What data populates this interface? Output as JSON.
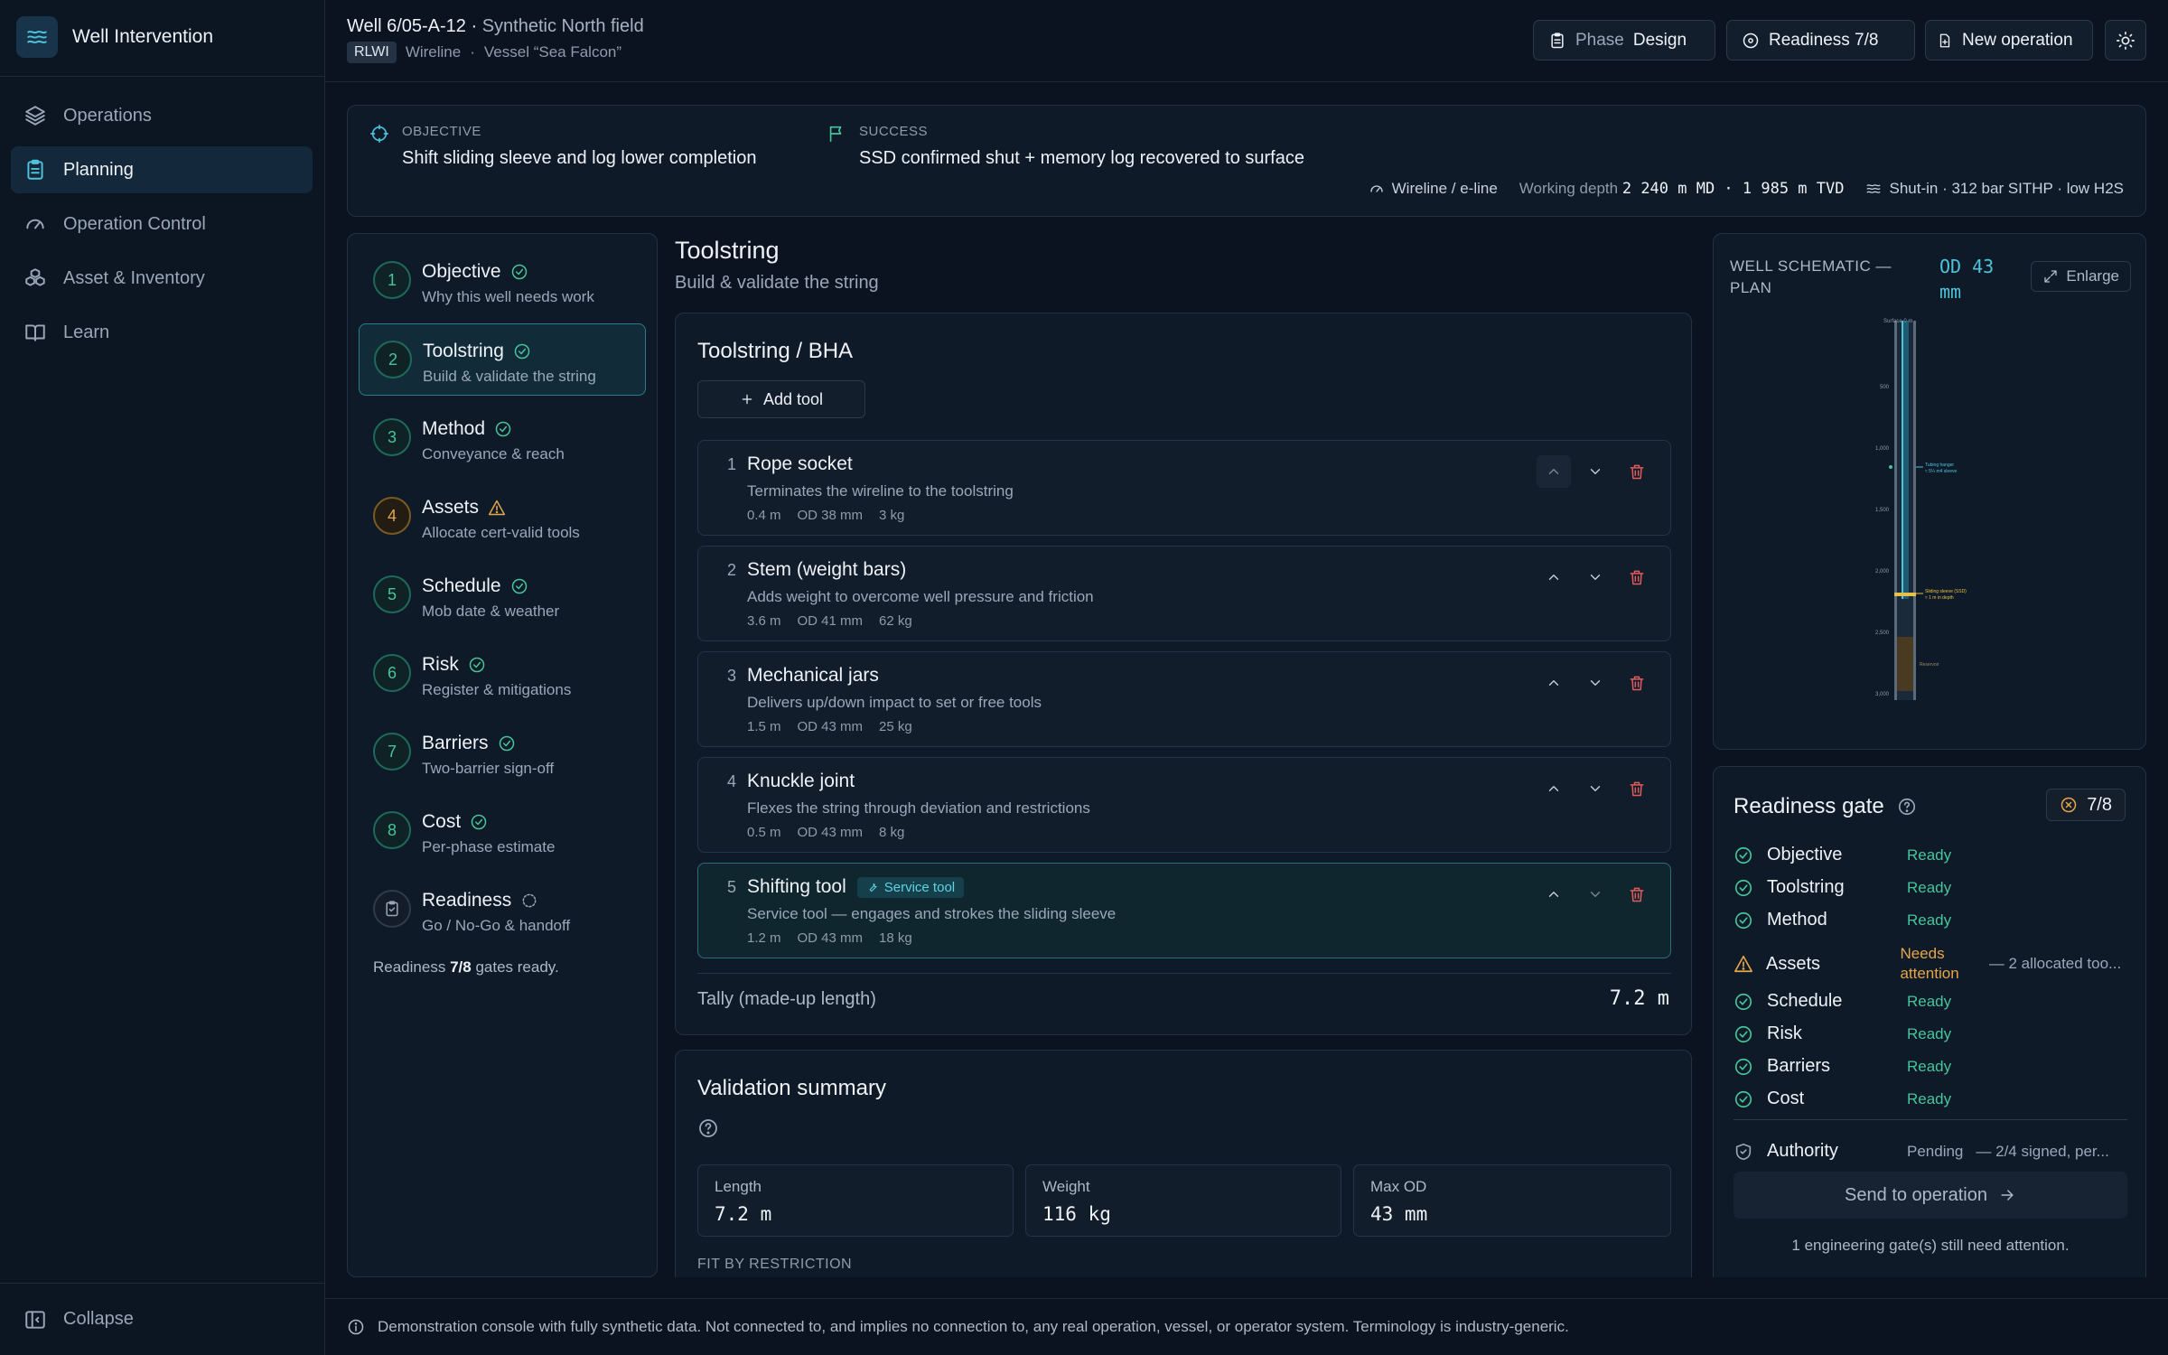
{
  "app": {
    "title": "Well Intervention"
  },
  "nav": [
    {
      "label": "Operations",
      "icon": "layers-icon"
    },
    {
      "label": "Planning",
      "icon": "clipboard-icon",
      "active": true
    },
    {
      "label": "Operation Control",
      "icon": "gauge-icon"
    },
    {
      "label": "Asset & Inventory",
      "icon": "boxes-icon"
    },
    {
      "label": "Learn",
      "icon": "book-icon"
    }
  ],
  "collapse_label": "Collapse",
  "header": {
    "well": "Well 6/05-A-12",
    "dot": "·",
    "field": "Synthetic North field",
    "tag": "RLWI",
    "mode": "Wireline",
    "vessel": "Vessel “Sea Falcon”",
    "phase_label": "Phase",
    "phase_value": "Design",
    "readiness": "Readiness 7/8",
    "new_operation": "New operation"
  },
  "banner": {
    "objective_label": "OBJECTIVE",
    "objective": "Shift sliding sleeve and log lower completion",
    "success_label": "SUCCESS",
    "success": "SSD confirmed shut + memory log recovered to surface",
    "conveyance": "Wireline / e-line",
    "depth_label": "Working depth",
    "depth": "2 240 m MD · 1 985 m TVD",
    "well_state": "Shut-in · 312 bar SITHP · low H2S"
  },
  "steps": [
    {
      "num": "1",
      "title": "Objective",
      "sub": "Why this well needs work",
      "state": "ok"
    },
    {
      "num": "2",
      "title": "Toolstring",
      "sub": "Build & validate the string",
      "state": "ok"
    },
    {
      "num": "3",
      "title": "Method",
      "sub": "Conveyance & reach",
      "state": "ok"
    },
    {
      "num": "4",
      "title": "Assets",
      "sub": "Allocate cert-valid tools",
      "state": "warn"
    },
    {
      "num": "5",
      "title": "Schedule",
      "sub": "Mob date & weather",
      "state": "ok"
    },
    {
      "num": "6",
      "title": "Risk",
      "sub": "Register & mitigations",
      "state": "ok"
    },
    {
      "num": "7",
      "title": "Barriers",
      "sub": "Two-barrier sign-off",
      "state": "ok"
    },
    {
      "num": "8",
      "title": "Cost",
      "sub": "Per-phase estimate",
      "state": "ok"
    },
    {
      "num": "",
      "title": "Readiness",
      "sub": "Go / No-Go & handoff",
      "state": "pending"
    }
  ],
  "steps_footer": {
    "prefix": "Readiness",
    "value": "7/8",
    "suffix": "gates ready."
  },
  "main": {
    "title": "Toolstring",
    "subtitle": "Build & validate the string"
  },
  "bha": {
    "title": "Toolstring / BHA",
    "add_tool": "Add tool",
    "tools": [
      {
        "n": "1",
        "name": "Rope socket",
        "desc": "Terminates the wireline to the toolstring",
        "length": "0.4 m",
        "od": "OD 38 mm",
        "weight": "3 kg"
      },
      {
        "n": "2",
        "name": "Stem (weight bars)",
        "desc": "Adds weight to overcome well pressure and friction",
        "length": "3.6 m",
        "od": "OD 41 mm",
        "weight": "62 kg"
      },
      {
        "n": "3",
        "name": "Mechanical jars",
        "desc": "Delivers up/down impact to set or free tools",
        "length": "1.5 m",
        "od": "OD 43 mm",
        "weight": "25 kg"
      },
      {
        "n": "4",
        "name": "Knuckle joint",
        "desc": "Flexes the string through deviation and restrictions",
        "length": "0.5 m",
        "od": "OD 43 mm",
        "weight": "8 kg"
      },
      {
        "n": "5",
        "name": "Shifting tool",
        "badge": "Service tool",
        "desc": "Service tool — engages and strokes the sliding sleeve",
        "length": "1.2 m",
        "od": "OD 43 mm",
        "weight": "18 kg"
      }
    ],
    "tally_label": "Tally (made-up length)",
    "tally_value": "7.2 m"
  },
  "validation": {
    "title": "Validation summary",
    "length_label": "Length",
    "length": "7.2 m",
    "weight_label": "Weight",
    "weight": "116 kg",
    "maxod_label": "Max OD",
    "maxod": "43 mm",
    "fit_label": "FIT BY RESTRICTION"
  },
  "schematic": {
    "title": "WELL SCHEMATIC — PLAN",
    "od": "OD 43 mm",
    "enlarge": "Enlarge",
    "surface_label": "Surface 0 m",
    "depth_ticks": [
      "500",
      "1,000",
      "1,500",
      "2,000",
      "2,500",
      "3,000"
    ],
    "tubing_label": "Tubing hanger",
    "tubing_sub": "≈ 5¼ m4 sleeve",
    "ssd_label": "Sliding sleeve (SSD)",
    "ssd_sub": "≈ 1 m in depth",
    "reservoir_label": "Reservoir"
  },
  "gate": {
    "title": "Readiness gate",
    "score": "7/8",
    "rows": [
      {
        "name": "Objective",
        "status": "Ready",
        "state": "ok"
      },
      {
        "name": "Toolstring",
        "status": "Ready",
        "state": "ok"
      },
      {
        "name": "Method",
        "status": "Ready",
        "state": "ok"
      },
      {
        "name": "Assets",
        "status": "Needs attention",
        "state": "warn",
        "detail": "— 2 allocated too..."
      },
      {
        "name": "Schedule",
        "status": "Ready",
        "state": "ok"
      },
      {
        "name": "Risk",
        "status": "Ready",
        "state": "ok"
      },
      {
        "name": "Barriers",
        "status": "Ready",
        "state": "ok"
      },
      {
        "name": "Cost",
        "status": "Ready",
        "state": "ok"
      }
    ],
    "authority": {
      "name": "Authority",
      "status": "Pending",
      "detail": "— 2/4 signed, per..."
    },
    "send": "Send to operation",
    "footer": "1 engineering gate(s) still need attention."
  },
  "footer": "Demonstration console with fully synthetic data. Not connected to, and implies no connection to, any real operation, vessel, or operator system. Terminology is industry-generic.",
  "colors": {
    "accent": "#4fc3d9",
    "ok": "#46c49a",
    "warn": "#e5a64a",
    "danger": "#e05a5a"
  }
}
